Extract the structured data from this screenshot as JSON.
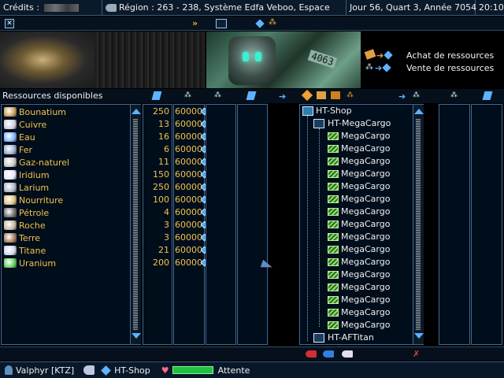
{
  "topbar": {
    "credits_label": "Crédits :",
    "region_label": "Région : 263 - 238, Système Edfa Veboo, Espace",
    "date_label": "Jour 56, Quart 3, Année 7054",
    "time_label": "20:10"
  },
  "banner": {
    "ship_tag": "4063",
    "buy_label": "Achat de ressources",
    "sell_label": "Vente de ressources"
  },
  "header": {
    "resources_title": "Ressources disponibles"
  },
  "resources": [
    {
      "name": "Bounatium",
      "qty": "250",
      "cap": "60000",
      "color": "#c9a05a"
    },
    {
      "name": "Cuivre",
      "qty": "13",
      "cap": "60000",
      "color": "#d0d0e0"
    },
    {
      "name": "Eau",
      "qty": "16",
      "cap": "60000",
      "color": "#7fb6ff"
    },
    {
      "name": "Fer",
      "qty": "6",
      "cap": "60000",
      "color": "#9ab0d0"
    },
    {
      "name": "Gaz-naturel",
      "qty": "11",
      "cap": "60000",
      "color": "#c8c8c8"
    },
    {
      "name": "Iridium",
      "qty": "150",
      "cap": "60000",
      "color": "#e6e6ff"
    },
    {
      "name": "Larium",
      "qty": "250",
      "cap": "60000",
      "color": "#b0b8c8"
    },
    {
      "name": "Nourriture",
      "qty": "100",
      "cap": "60000",
      "color": "#e0c080"
    },
    {
      "name": "Pétrole",
      "qty": "4",
      "cap": "60000",
      "color": "#707070"
    },
    {
      "name": "Roche",
      "qty": "3",
      "cap": "60000",
      "color": "#c8b8a0"
    },
    {
      "name": "Terre",
      "qty": "3",
      "cap": "60000",
      "color": "#a88060"
    },
    {
      "name": "Titane",
      "qty": "21",
      "cap": "60000",
      "color": "#d0d8e8"
    },
    {
      "name": "Uranium",
      "qty": "200",
      "cap": "60000",
      "color": "#60d060"
    }
  ],
  "tree": {
    "root": "HT-Shop",
    "group": "HT-MegaCargo",
    "items": [
      "MegaCargo",
      "MegaCargo",
      "MegaCargo",
      "MegaCargo",
      "MegaCargo",
      "MegaCargo",
      "MegaCargo",
      "MegaCargo",
      "MegaCargo",
      "MegaCargo",
      "MegaCargo",
      "MegaCargo",
      "MegaCargo",
      "MegaCargo",
      "MegaCargo",
      "MegaCargo"
    ],
    "last": "HT-AFTitan"
  },
  "status": {
    "player": "Valphyr [KTZ]",
    "location": "HT-Shop",
    "state": "Attente",
    "health_fraction": 1.0
  },
  "colors": {
    "accent": "#3f6a96",
    "gold": "#f0c24a",
    "green_bar": "#22c040"
  }
}
